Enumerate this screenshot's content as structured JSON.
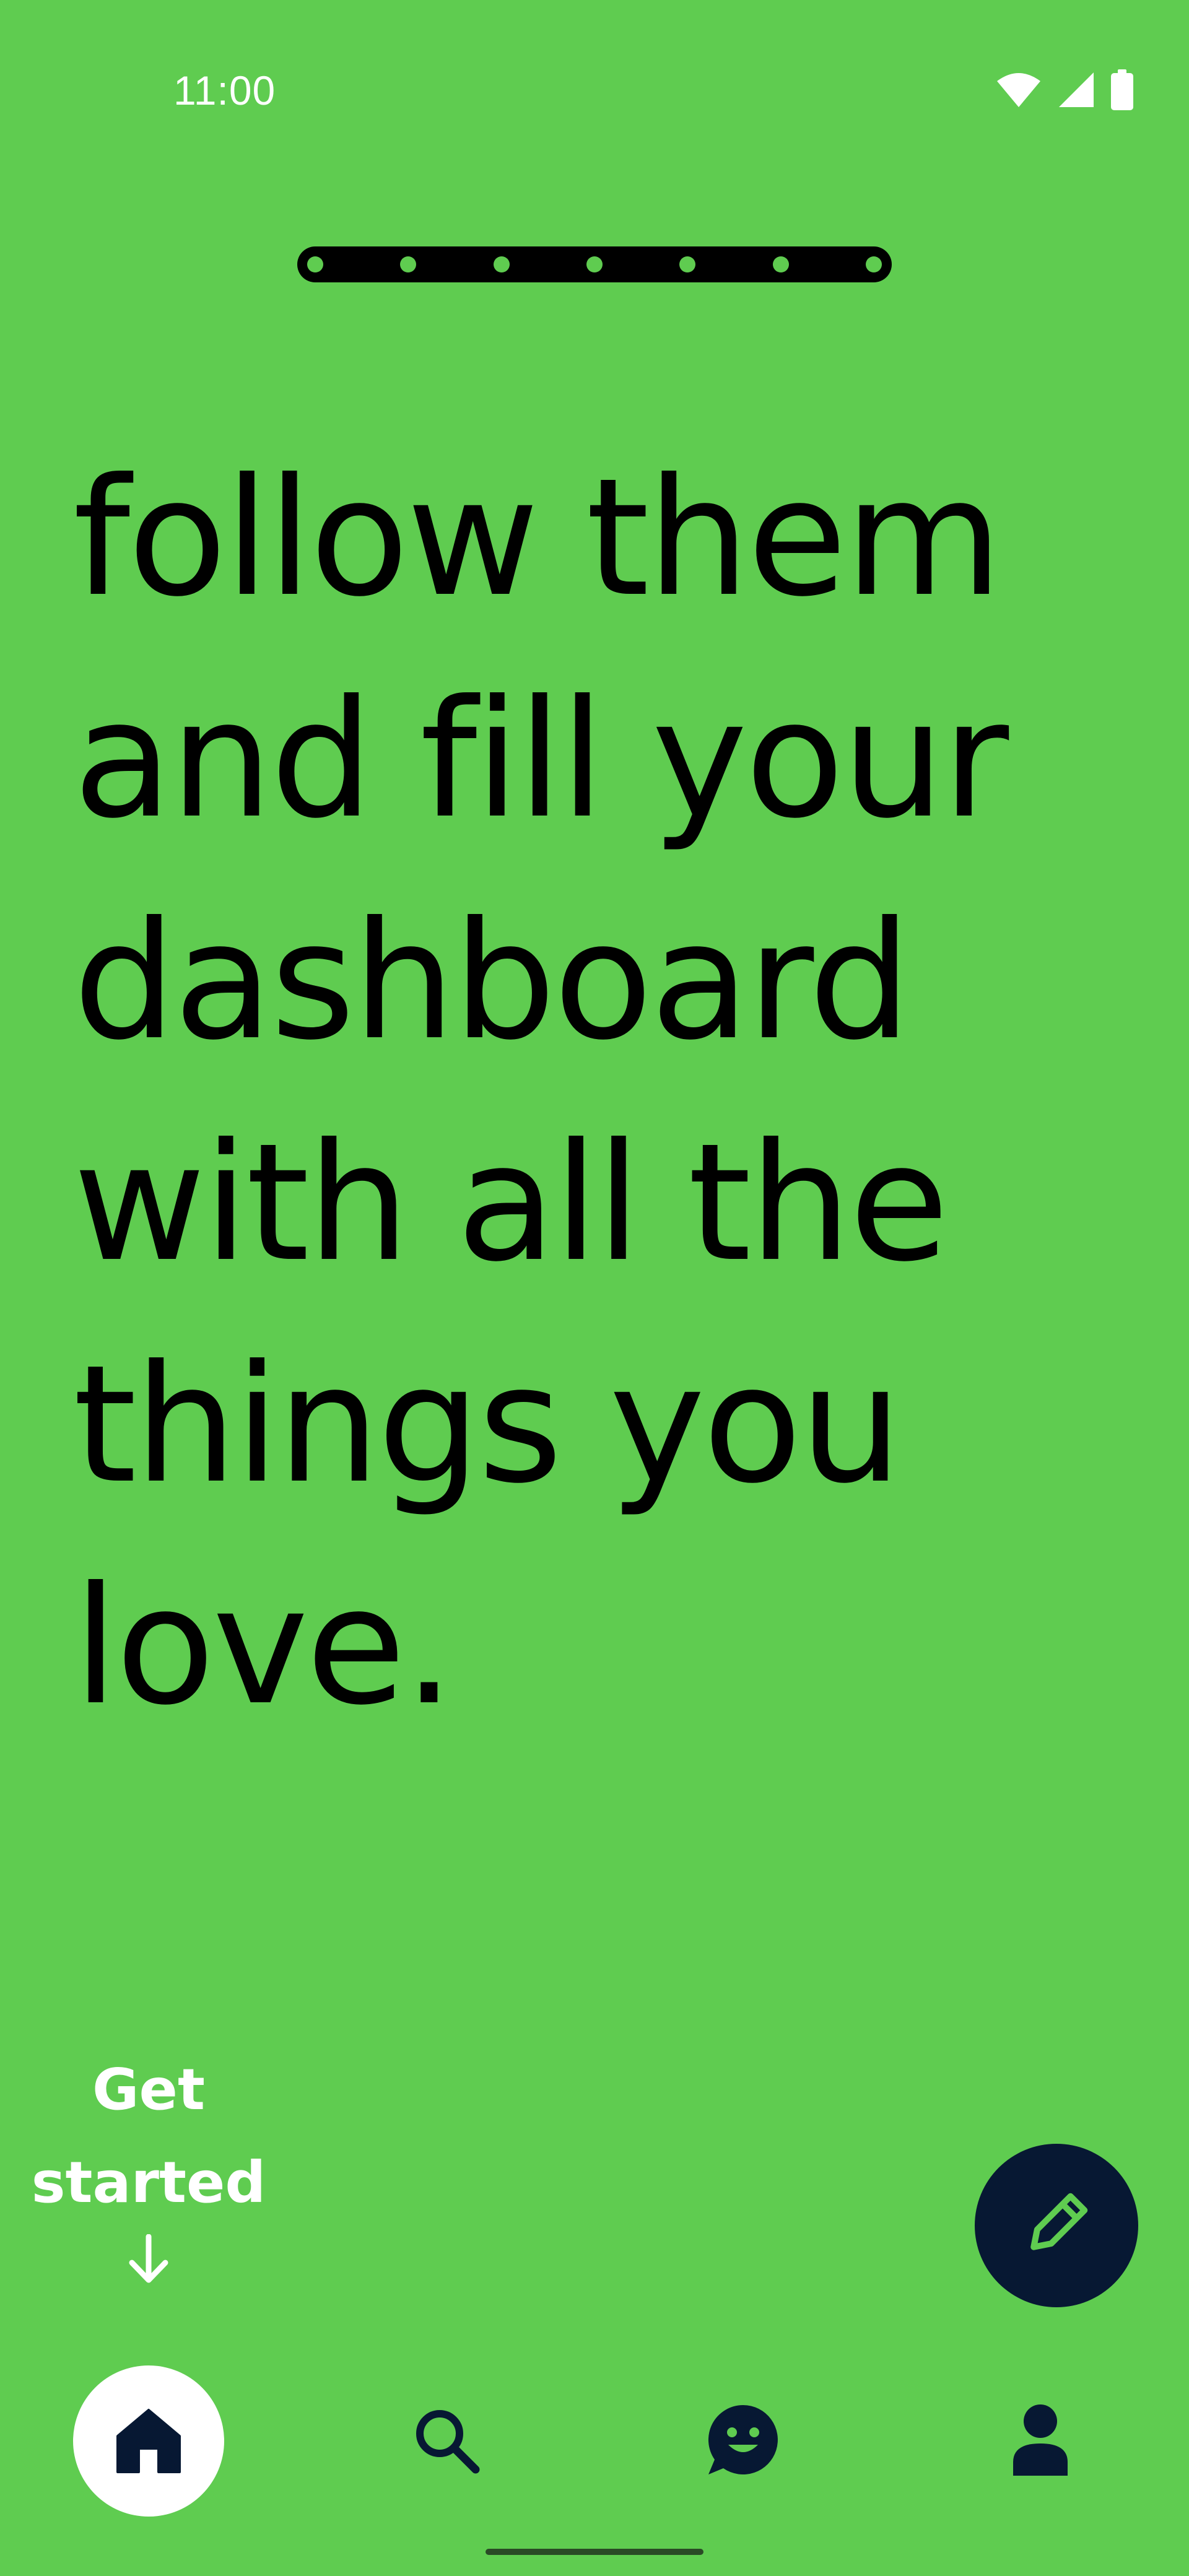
{
  "status_bar": {
    "time": "11:00",
    "icons": [
      "wifi-icon",
      "cellular-signal-icon",
      "battery-icon"
    ]
  },
  "onboarding": {
    "total_steps": 7,
    "headline": "follow them\nand fill your\ndashboard\nwith all the\nthings you\nlove."
  },
  "get_started": {
    "label": "Get\nstarted",
    "icon": "arrow-down-icon"
  },
  "fab": {
    "icon": "pencil-icon"
  },
  "bottom_nav": {
    "items": [
      {
        "id": "home",
        "icon": "home-icon",
        "active": true
      },
      {
        "id": "search",
        "icon": "search-icon",
        "active": false
      },
      {
        "id": "messages",
        "icon": "chat-smiley-icon",
        "active": false
      },
      {
        "id": "profile",
        "icon": "person-icon",
        "active": false
      }
    ]
  },
  "colors": {
    "background": "#5fcc50",
    "dark": "#071833",
    "text": "#000000",
    "light": "#ffffff"
  }
}
